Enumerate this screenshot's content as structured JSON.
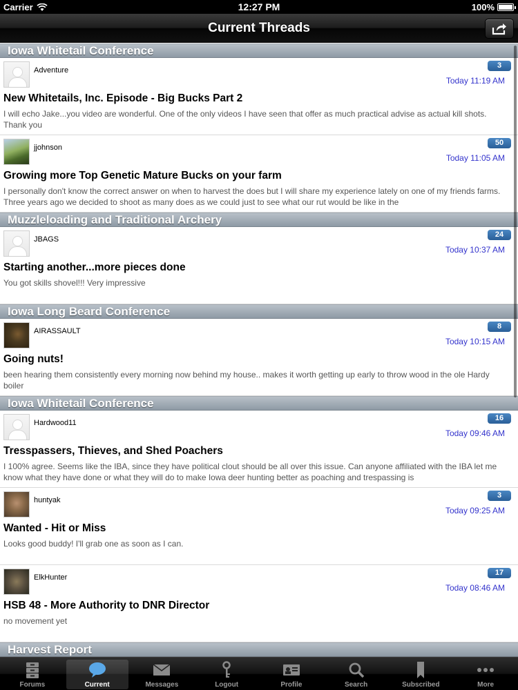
{
  "status_bar": {
    "carrier": "Carrier",
    "time": "12:27 PM",
    "battery": "100%"
  },
  "nav": {
    "title": "Current Threads",
    "share_icon": "share-icon"
  },
  "sections": [
    {
      "title": "Iowa Whitetail Conference",
      "threads": [
        {
          "author": "Adventure",
          "replies": "3",
          "time": "Today 11:19 AM",
          "subject": "New Whitetails, Inc. Episode - Big Bucks Part 2",
          "preview": "I will echo Jake...you video are wonderful.  One of the only videos I have seen that offer as much practical advise as actual kill shots.  Thank you",
          "avatar": "placeholder"
        },
        {
          "author": "jjohnson",
          "replies": "50",
          "time": "Today 11:05 AM",
          "subject": "Growing more Top Genetic Mature Bucks on your farm",
          "preview": "I personally don't know the correct answer on when to harvest the does but I will share my experience lately on one of my friends farms.  Three years ago we decided to shoot as many does as we could just to see what our rut would be like in the",
          "avatar": "tree"
        }
      ]
    },
    {
      "title": "Muzzleloading and Traditional Archery",
      "threads": [
        {
          "author": "JBAGS",
          "replies": "24",
          "time": "Today 10:37 AM",
          "subject": "Starting another...more pieces done",
          "preview": "You got skills shovel!!! Very impressive",
          "avatar": "placeholder"
        }
      ]
    },
    {
      "title": "Iowa Long Beard Conference",
      "threads": [
        {
          "author": "AIRASSAULT",
          "replies": "8",
          "time": "Today 10:15 AM",
          "subject": "Going nuts!",
          "preview": "been hearing them consistently every morning now behind my house..  makes it worth getting up early to throw wood in the ole Hardy boiler",
          "avatar": "turkey"
        }
      ]
    },
    {
      "title": "Iowa Whitetail Conference",
      "threads": [
        {
          "author": "Hardwood11",
          "replies": "16",
          "time": "Today 09:46 AM",
          "subject": "Tresspassers, Thieves, and Shed Poachers",
          "preview": "I 100% agree.  Seems like the IBA, since they have political clout should be all over this issue.  Can anyone affiliated with the IBA let me know what they have done or what they will do to make Iowa deer hunting better as poaching and trespassing is",
          "avatar": "placeholder"
        },
        {
          "author": "huntyak",
          "replies": "3",
          "time": "Today 09:25 AM",
          "subject": "Wanted - Hit or Miss",
          "preview": "Looks good buddy! I'll grab one as soon as I can.",
          "avatar": "dog"
        },
        {
          "author": "ElkHunter",
          "replies": "17",
          "time": "Today 08:46 AM",
          "subject": "HSB 48 - More Authority to DNR Director",
          "preview": "no movement yet",
          "avatar": "elk"
        }
      ]
    },
    {
      "title": "Harvest Report",
      "threads": []
    }
  ],
  "tabs": [
    {
      "label": "Forums",
      "icon": "forums-icon"
    },
    {
      "label": "Current",
      "icon": "current-icon",
      "active": true
    },
    {
      "label": "Messages",
      "icon": "messages-icon"
    },
    {
      "label": "Logout",
      "icon": "key-icon"
    },
    {
      "label": "Profile",
      "icon": "profile-icon"
    },
    {
      "label": "Search",
      "icon": "search-icon"
    },
    {
      "label": "Subscribed",
      "icon": "bookmark-icon"
    },
    {
      "label": "More",
      "icon": "more-icon"
    }
  ],
  "colors": {
    "badge": "#2a5f98",
    "time_text": "#3333cc",
    "section_header": "#8e9aa5"
  }
}
